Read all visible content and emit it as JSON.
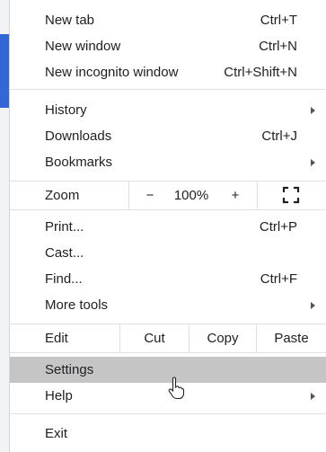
{
  "menu": {
    "new_tab": {
      "label": "New tab",
      "shortcut": "Ctrl+T"
    },
    "new_window": {
      "label": "New window",
      "shortcut": "Ctrl+N"
    },
    "new_incognito": {
      "label": "New incognito window",
      "shortcut": "Ctrl+Shift+N"
    },
    "history": {
      "label": "History"
    },
    "downloads": {
      "label": "Downloads",
      "shortcut": "Ctrl+J"
    },
    "bookmarks": {
      "label": "Bookmarks"
    },
    "zoom": {
      "label": "Zoom",
      "minus": "−",
      "level": "100%",
      "plus": "+"
    },
    "print": {
      "label": "Print...",
      "shortcut": "Ctrl+P"
    },
    "cast": {
      "label": "Cast..."
    },
    "find": {
      "label": "Find...",
      "shortcut": "Ctrl+F"
    },
    "more_tools": {
      "label": "More tools"
    },
    "edit": {
      "label": "Edit",
      "cut": "Cut",
      "copy": "Copy",
      "paste": "Paste"
    },
    "settings": {
      "label": "Settings",
      "state": "hovered"
    },
    "help": {
      "label": "Help"
    },
    "exit": {
      "label": "Exit"
    }
  },
  "colors": {
    "hover": "#c5c5c5",
    "separator": "#e0e0e0",
    "accent": "#3367d6"
  },
  "icons": {
    "fullscreen": "fullscreen-icon",
    "submenu": "chevron-right-icon",
    "cursor": "mouse-pointer-icon"
  }
}
